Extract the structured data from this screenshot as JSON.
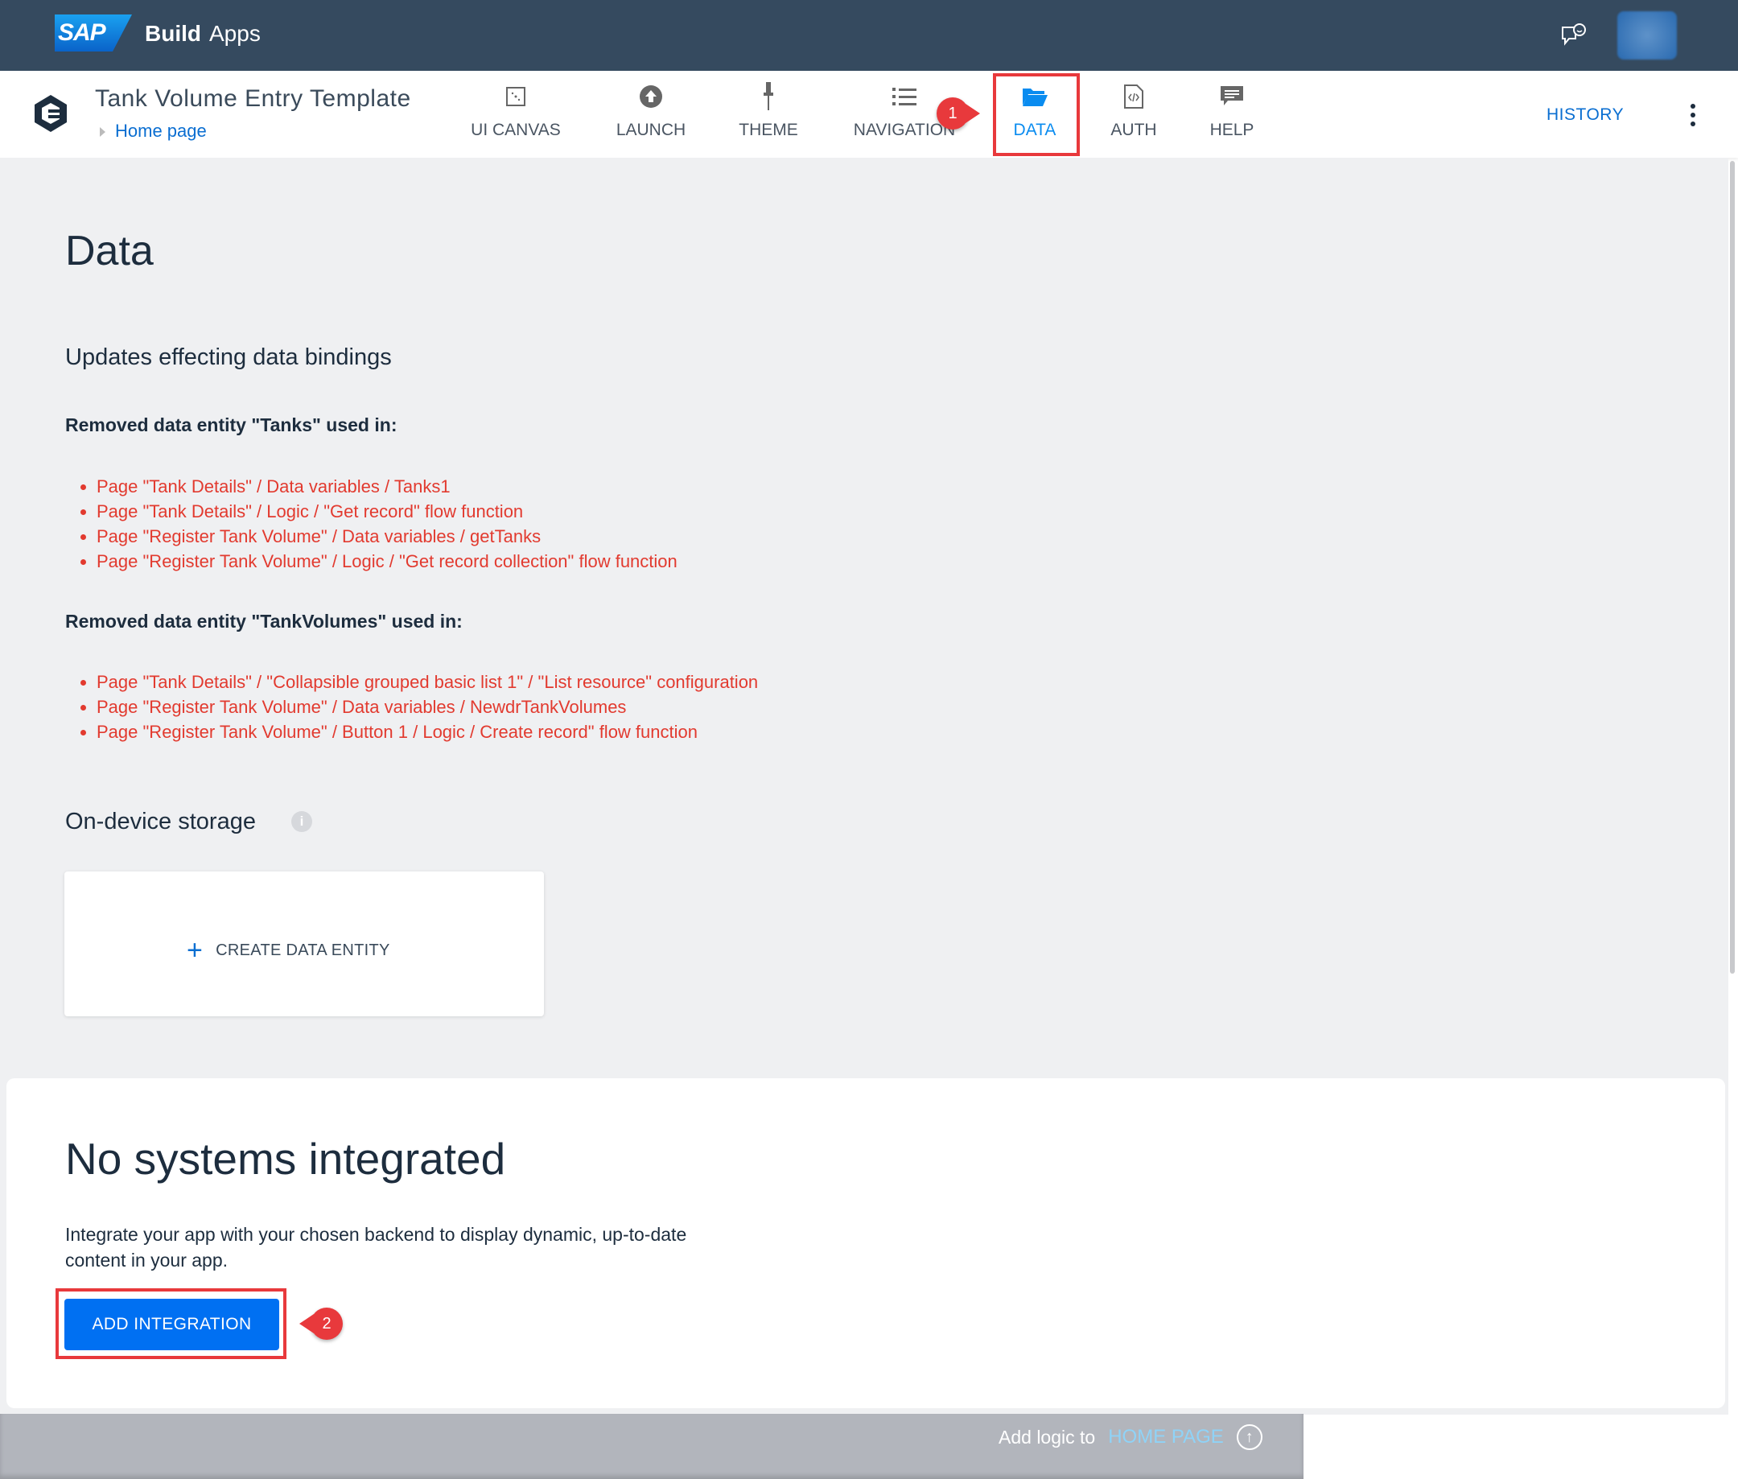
{
  "header": {
    "logo": "SAP",
    "brand_bold": "Build",
    "brand": "Apps",
    "feedback_icon": "feedback-icon",
    "accent": "#354a5f"
  },
  "app": {
    "title": "Tank Volume Entry Template",
    "breadcrumb": "Home page",
    "history": "HISTORY"
  },
  "tabs": [
    {
      "label": "UI CANVAS",
      "icon": "canvas-icon"
    },
    {
      "label": "LAUNCH",
      "icon": "launch-icon"
    },
    {
      "label": "THEME",
      "icon": "theme-icon"
    },
    {
      "label": "NAVIGATION",
      "icon": "list-icon"
    },
    {
      "label": "DATA",
      "icon": "folder-icon",
      "active": true
    },
    {
      "label": "AUTH",
      "icon": "auth-icon"
    },
    {
      "label": "HELP",
      "icon": "help-icon"
    }
  ],
  "annotations": {
    "one": "1",
    "two": "2",
    "color": "#e8393c"
  },
  "main": {
    "title": "Data",
    "updates_heading": "Updates effecting data bindings",
    "groups": [
      {
        "heading": "Removed data entity \"Tanks\" used in:",
        "items": [
          "Page \"Tank Details\" / Data variables / Tanks1",
          "Page \"Tank Details\" / Logic / \"Get record\" flow function",
          "Page \"Register Tank Volume\" / Data variables / getTanks",
          "Page \"Register Tank Volume\" / Logic / \"Get record collection\" flow function"
        ]
      },
      {
        "heading": "Removed data entity \"TankVolumes\" used in:",
        "items": [
          "Page \"Tank Details\" / \"Collapsible grouped basic list 1\" / \"List resource\" configuration",
          "Page \"Register Tank Volume\" / Data variables / NewdrTankVolumes",
          "Page \"Register Tank Volume\" / Button 1 / Logic / Create record\" flow function"
        ]
      }
    ],
    "storage_heading": "On-device storage",
    "info": "i",
    "create_entity": "CREATE DATA ENTITY",
    "create_plus": "+"
  },
  "integration": {
    "title": "No systems integrated",
    "description": "Integrate your app with your chosen backend to display dynamic, up-to-date content in your app.",
    "button": "ADD INTEGRATION"
  },
  "footer": {
    "add_logic": "Add logic to",
    "page": "HOME PAGE",
    "arrow": "↑"
  }
}
